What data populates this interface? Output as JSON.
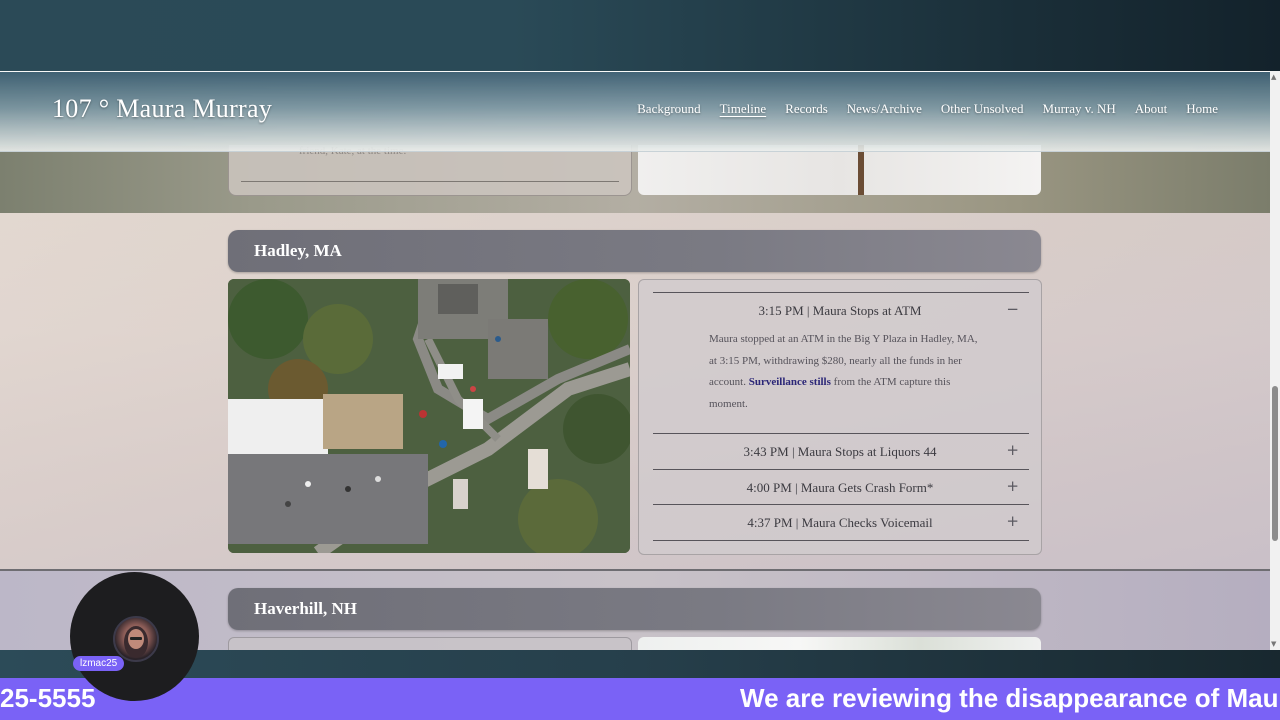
{
  "site": {
    "brand": "107 ° Maura Murray",
    "nav": [
      "Background",
      "Timeline",
      "Records",
      "News/Archive",
      "Other Unsolved",
      "Murray v. NH",
      "About",
      "Home"
    ],
    "active_nav": "Timeline"
  },
  "previous_section": {
    "text_fragment": "friend, Kate, at the time."
  },
  "hadley_section": {
    "location": "Hadley, MA",
    "events": [
      {
        "title": "3:15 PM | Maura Stops at ATM",
        "expanded": true,
        "toggle": "−",
        "body_before": "Maura stopped at an ATM in the Big Y Plaza in Hadley, MA, at 3:15 PM, withdrawing $280, nearly all the funds in her account.",
        "link_text": "Surveillance stills",
        "body_after": "from the ATM capture this moment."
      },
      {
        "title": "3:43 PM | Maura Stops at Liquors 44",
        "expanded": false,
        "toggle": "+"
      },
      {
        "title": "4:00 PM | Maura Gets Crash Form*",
        "expanded": false,
        "toggle": "+"
      },
      {
        "title": "4:37 PM | Maura Checks Voicemail",
        "expanded": false,
        "toggle": "+"
      }
    ]
  },
  "haverhill_section": {
    "location": "Haverhill, NH"
  },
  "stream_overlay": {
    "username": "lzmac25",
    "ticker_left": "25-5555",
    "ticker_right": "We are reviewing the disappearance of Maura"
  },
  "colors": {
    "ticker": "#7a62f6",
    "link": "#2b2677",
    "header_bar": "#7a7a83"
  }
}
